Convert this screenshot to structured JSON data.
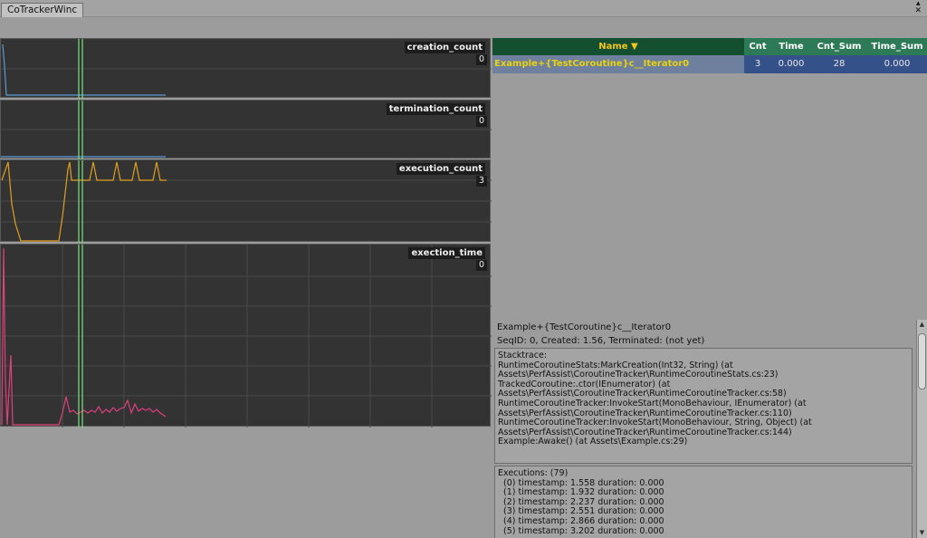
{
  "window": {
    "tab_title": "CoTrackerWinc"
  },
  "graphs": [
    {
      "label": "creation_count",
      "value": "0"
    },
    {
      "label": "termination_count",
      "value": "0"
    },
    {
      "label": "execution_count",
      "value": "3"
    },
    {
      "label": "exection_time",
      "value": "0"
    }
  ],
  "table": {
    "headers": {
      "name": "Name ▼",
      "cnt": "Cnt",
      "time": "Time",
      "cnt_sum": "Cnt_Sum",
      "time_sum": "Time_Sum"
    },
    "rows": [
      {
        "name": "Example+{TestCoroutine}c__Iterator0",
        "cnt": "3",
        "time": "0.000",
        "cnt_sum": "28",
        "time_sum": "0.000"
      }
    ]
  },
  "details": {
    "title": "Example+{TestCoroutine}c__Iterator0",
    "seq": "SeqID: 0, Created: 1.56, Terminated: (not yet)",
    "stacktrace_lines": [
      "Stacktrace:",
      "",
      "RuntimeCoroutineStats:MarkCreation(Int32, String) (at",
      "Assets\\PerfAssist\\CoroutineTracker\\RuntimeCoroutineStats.cs:23)",
      "TrackedCoroutine:.ctor(IEnumerator) (at",
      "Assets\\PerfAssist\\CoroutineTracker\\RuntimeCoroutineTracker.cs:58)",
      "RuntimeCoroutineTracker:InvokeStart(MonoBehaviour, IEnumerator) (at",
      "Assets\\PerfAssist\\CoroutineTracker\\RuntimeCoroutineTracker.cs:110)",
      "RuntimeCoroutineTracker:InvokeStart(MonoBehaviour, String, Object) (at",
      "Assets\\PerfAssist\\CoroutineTracker\\RuntimeCoroutineTracker.cs:144)",
      "Example:Awake() (at Assets\\Example.cs:29)"
    ],
    "executions_lines": [
      "Executions: (79)",
      "",
      "  (0) timestamp: 1.558 duration: 0.000",
      "  (1) timestamp: 1.932 duration: 0.000",
      "  (2) timestamp: 2.237 duration: 0.000",
      "  (3) timestamp: 2.551 duration: 0.000",
      "  (4) timestamp: 2.866 duration: 0.000",
      "  (5) timestamp: 3.202 duration: 0.000"
    ]
  },
  "colors": {
    "header_green": "#2d7a57",
    "name_header": "#14502f",
    "creation_line": "#5b9bd5",
    "execution_line": "#e0a020",
    "time_line": "#e0407a",
    "cursor_line": "#7ee07e"
  },
  "icons": {
    "window_buttons": [
      "maximize-icon",
      "close-icon"
    ]
  }
}
